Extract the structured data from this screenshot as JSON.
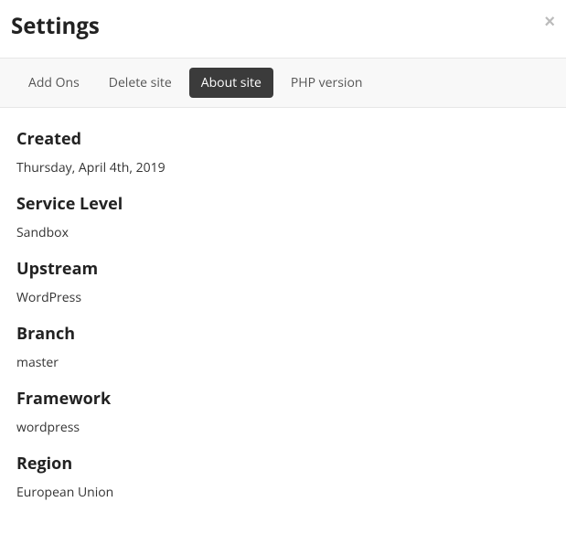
{
  "modal": {
    "title": "Settings"
  },
  "tabs": [
    {
      "label": "Add Ons"
    },
    {
      "label": "Delete site"
    },
    {
      "label": "About site"
    },
    {
      "label": "PHP version"
    }
  ],
  "about": {
    "fields": [
      {
        "label": "Created",
        "value": "Thursday, April 4th, 2019"
      },
      {
        "label": "Service Level",
        "value": "Sandbox"
      },
      {
        "label": "Upstream",
        "value": "WordPress"
      },
      {
        "label": "Branch",
        "value": "master"
      },
      {
        "label": "Framework",
        "value": "wordpress"
      },
      {
        "label": "Region",
        "value": "European Union"
      }
    ]
  }
}
